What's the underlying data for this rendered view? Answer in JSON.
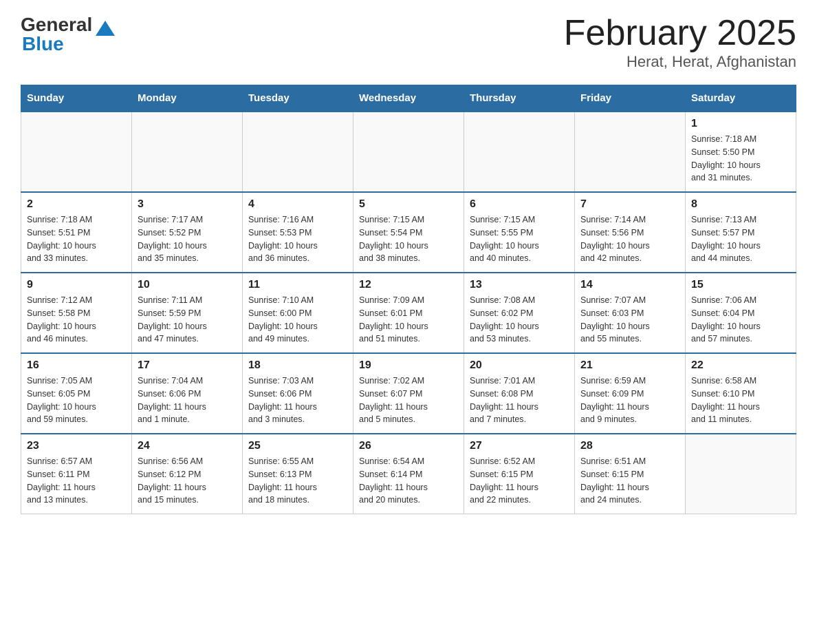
{
  "header": {
    "logo_general": "General",
    "logo_blue": "Blue",
    "title": "February 2025",
    "subtitle": "Herat, Herat, Afghanistan"
  },
  "weekdays": [
    "Sunday",
    "Monday",
    "Tuesday",
    "Wednesday",
    "Thursday",
    "Friday",
    "Saturday"
  ],
  "weeks": [
    [
      {
        "day": "",
        "info": ""
      },
      {
        "day": "",
        "info": ""
      },
      {
        "day": "",
        "info": ""
      },
      {
        "day": "",
        "info": ""
      },
      {
        "day": "",
        "info": ""
      },
      {
        "day": "",
        "info": ""
      },
      {
        "day": "1",
        "info": "Sunrise: 7:18 AM\nSunset: 5:50 PM\nDaylight: 10 hours\nand 31 minutes."
      }
    ],
    [
      {
        "day": "2",
        "info": "Sunrise: 7:18 AM\nSunset: 5:51 PM\nDaylight: 10 hours\nand 33 minutes."
      },
      {
        "day": "3",
        "info": "Sunrise: 7:17 AM\nSunset: 5:52 PM\nDaylight: 10 hours\nand 35 minutes."
      },
      {
        "day": "4",
        "info": "Sunrise: 7:16 AM\nSunset: 5:53 PM\nDaylight: 10 hours\nand 36 minutes."
      },
      {
        "day": "5",
        "info": "Sunrise: 7:15 AM\nSunset: 5:54 PM\nDaylight: 10 hours\nand 38 minutes."
      },
      {
        "day": "6",
        "info": "Sunrise: 7:15 AM\nSunset: 5:55 PM\nDaylight: 10 hours\nand 40 minutes."
      },
      {
        "day": "7",
        "info": "Sunrise: 7:14 AM\nSunset: 5:56 PM\nDaylight: 10 hours\nand 42 minutes."
      },
      {
        "day": "8",
        "info": "Sunrise: 7:13 AM\nSunset: 5:57 PM\nDaylight: 10 hours\nand 44 minutes."
      }
    ],
    [
      {
        "day": "9",
        "info": "Sunrise: 7:12 AM\nSunset: 5:58 PM\nDaylight: 10 hours\nand 46 minutes."
      },
      {
        "day": "10",
        "info": "Sunrise: 7:11 AM\nSunset: 5:59 PM\nDaylight: 10 hours\nand 47 minutes."
      },
      {
        "day": "11",
        "info": "Sunrise: 7:10 AM\nSunset: 6:00 PM\nDaylight: 10 hours\nand 49 minutes."
      },
      {
        "day": "12",
        "info": "Sunrise: 7:09 AM\nSunset: 6:01 PM\nDaylight: 10 hours\nand 51 minutes."
      },
      {
        "day": "13",
        "info": "Sunrise: 7:08 AM\nSunset: 6:02 PM\nDaylight: 10 hours\nand 53 minutes."
      },
      {
        "day": "14",
        "info": "Sunrise: 7:07 AM\nSunset: 6:03 PM\nDaylight: 10 hours\nand 55 minutes."
      },
      {
        "day": "15",
        "info": "Sunrise: 7:06 AM\nSunset: 6:04 PM\nDaylight: 10 hours\nand 57 minutes."
      }
    ],
    [
      {
        "day": "16",
        "info": "Sunrise: 7:05 AM\nSunset: 6:05 PM\nDaylight: 10 hours\nand 59 minutes."
      },
      {
        "day": "17",
        "info": "Sunrise: 7:04 AM\nSunset: 6:06 PM\nDaylight: 11 hours\nand 1 minute."
      },
      {
        "day": "18",
        "info": "Sunrise: 7:03 AM\nSunset: 6:06 PM\nDaylight: 11 hours\nand 3 minutes."
      },
      {
        "day": "19",
        "info": "Sunrise: 7:02 AM\nSunset: 6:07 PM\nDaylight: 11 hours\nand 5 minutes."
      },
      {
        "day": "20",
        "info": "Sunrise: 7:01 AM\nSunset: 6:08 PM\nDaylight: 11 hours\nand 7 minutes."
      },
      {
        "day": "21",
        "info": "Sunrise: 6:59 AM\nSunset: 6:09 PM\nDaylight: 11 hours\nand 9 minutes."
      },
      {
        "day": "22",
        "info": "Sunrise: 6:58 AM\nSunset: 6:10 PM\nDaylight: 11 hours\nand 11 minutes."
      }
    ],
    [
      {
        "day": "23",
        "info": "Sunrise: 6:57 AM\nSunset: 6:11 PM\nDaylight: 11 hours\nand 13 minutes."
      },
      {
        "day": "24",
        "info": "Sunrise: 6:56 AM\nSunset: 6:12 PM\nDaylight: 11 hours\nand 15 minutes."
      },
      {
        "day": "25",
        "info": "Sunrise: 6:55 AM\nSunset: 6:13 PM\nDaylight: 11 hours\nand 18 minutes."
      },
      {
        "day": "26",
        "info": "Sunrise: 6:54 AM\nSunset: 6:14 PM\nDaylight: 11 hours\nand 20 minutes."
      },
      {
        "day": "27",
        "info": "Sunrise: 6:52 AM\nSunset: 6:15 PM\nDaylight: 11 hours\nand 22 minutes."
      },
      {
        "day": "28",
        "info": "Sunrise: 6:51 AM\nSunset: 6:15 PM\nDaylight: 11 hours\nand 24 minutes."
      },
      {
        "day": "",
        "info": ""
      }
    ]
  ]
}
